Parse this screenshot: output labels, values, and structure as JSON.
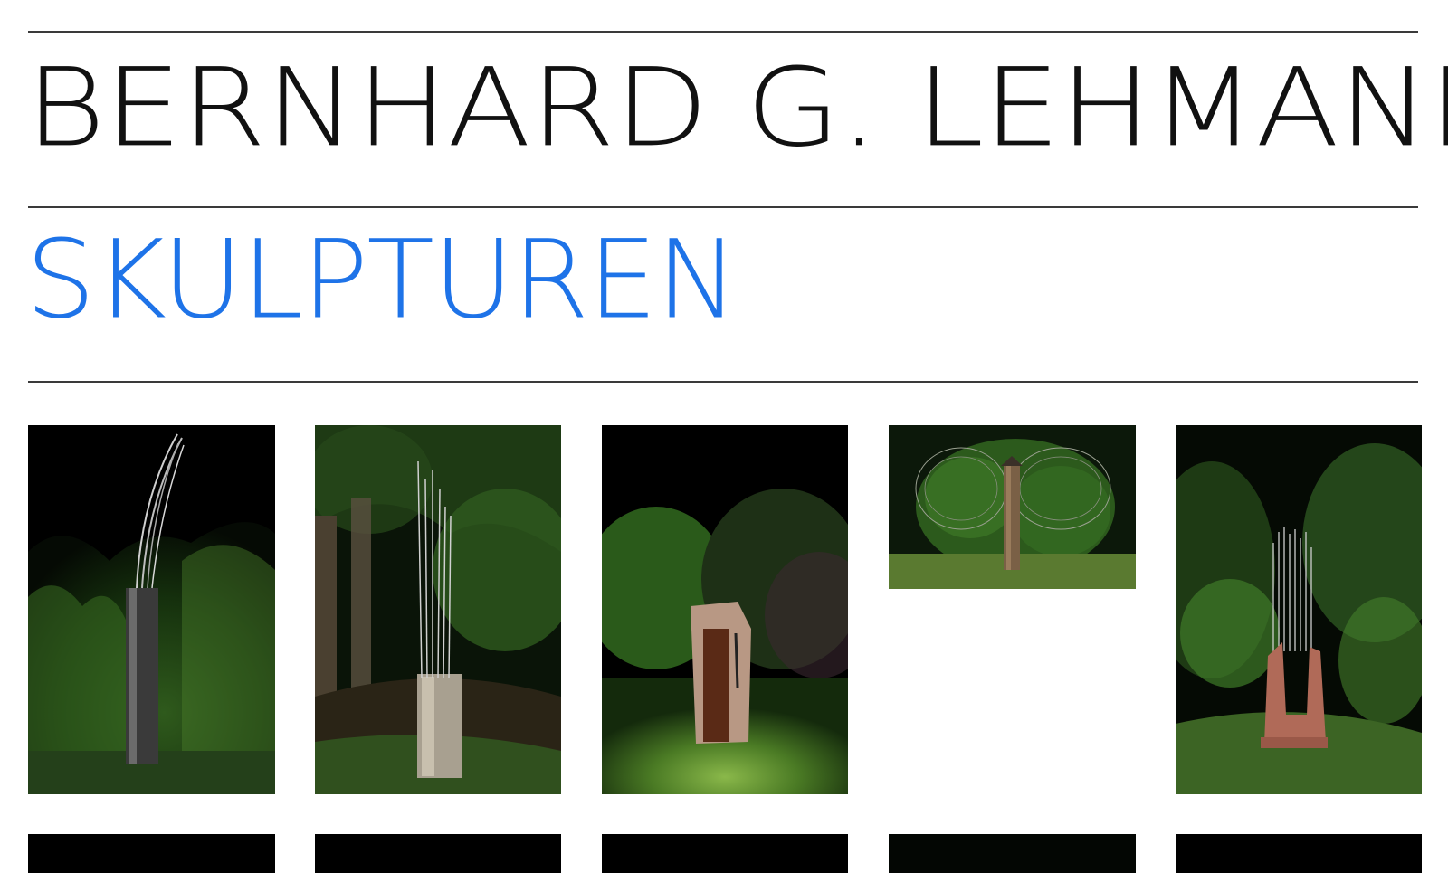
{
  "header": {
    "artist_name": "BERNHARD G. LEHMANN",
    "section_title": "SKULPTUREN"
  },
  "colors": {
    "accent": "#1e73e8",
    "text": "#111111",
    "rule": "#3a3a3a",
    "background": "#ffffff"
  },
  "gallery": {
    "items": [
      {
        "subject": "steel column with bent rods"
      },
      {
        "subject": "stone block with vertical rods"
      },
      {
        "subject": "stone monolith with dark inlay"
      },
      {
        "subject": "wooden post with wire circles"
      },
      {
        "subject": "red stone with vertical rods"
      },
      {
        "subject": "sculpture photo (partially visible)"
      },
      {
        "subject": "sculpture photo (partially visible)"
      },
      {
        "subject": "sculpture photo (partially visible)"
      },
      {
        "subject": "sculpture photo (partially visible)"
      },
      {
        "subject": "sculpture photo (partially visible)"
      }
    ]
  }
}
